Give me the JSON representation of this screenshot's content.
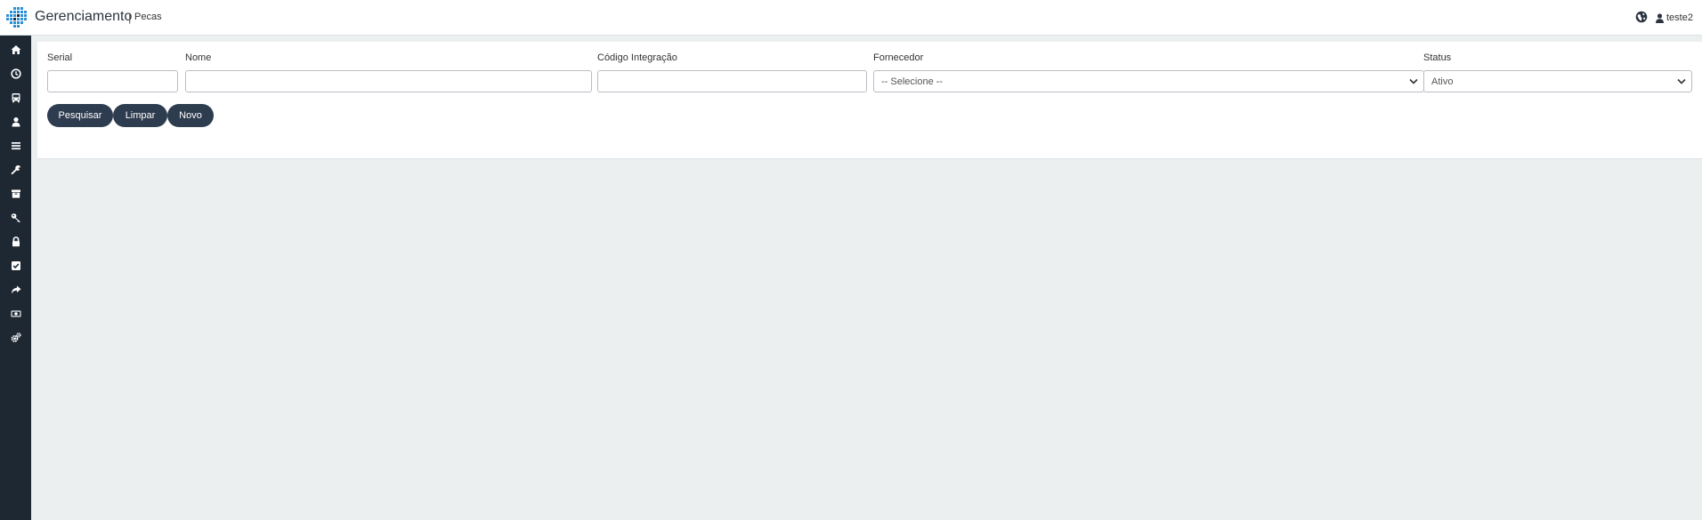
{
  "header": {
    "app_title": "Gerenciamento",
    "separator": "|",
    "page_title": "Pecas",
    "user_name": "teste2"
  },
  "icons": {
    "logo": "logo-grid-icon",
    "globe": "globe-icon",
    "user": "user-icon"
  },
  "sidebar": {
    "items": [
      {
        "icon": "home-icon"
      },
      {
        "icon": "clock-icon"
      },
      {
        "icon": "bus-icon"
      },
      {
        "icon": "user-icon"
      },
      {
        "icon": "list-icon"
      },
      {
        "icon": "wrench-icon"
      },
      {
        "icon": "archive-icon"
      },
      {
        "icon": "key-icon"
      },
      {
        "icon": "lock-icon"
      },
      {
        "icon": "check-square-icon"
      },
      {
        "icon": "share-icon"
      },
      {
        "icon": "money-icon"
      },
      {
        "icon": "cogs-icon"
      }
    ]
  },
  "filters": {
    "serial_label": "Serial",
    "serial_value": "",
    "nome_label": "Nome",
    "nome_value": "",
    "codigo_label": "Código Integração",
    "codigo_value": "",
    "fornecedor_label": "Fornecedor",
    "fornecedor_selected": "-- Selecione --",
    "status_label": "Status",
    "status_selected": "Ativo"
  },
  "actions": {
    "search_label": "Pesquisar",
    "clear_label": "Limpar",
    "new_label": "Novo"
  },
  "colors": {
    "sidebar_bg": "#1e2833",
    "button_bg": "#2e3c4f",
    "page_bg": "#eceff0",
    "logo_blue": "#2b8fd6"
  }
}
